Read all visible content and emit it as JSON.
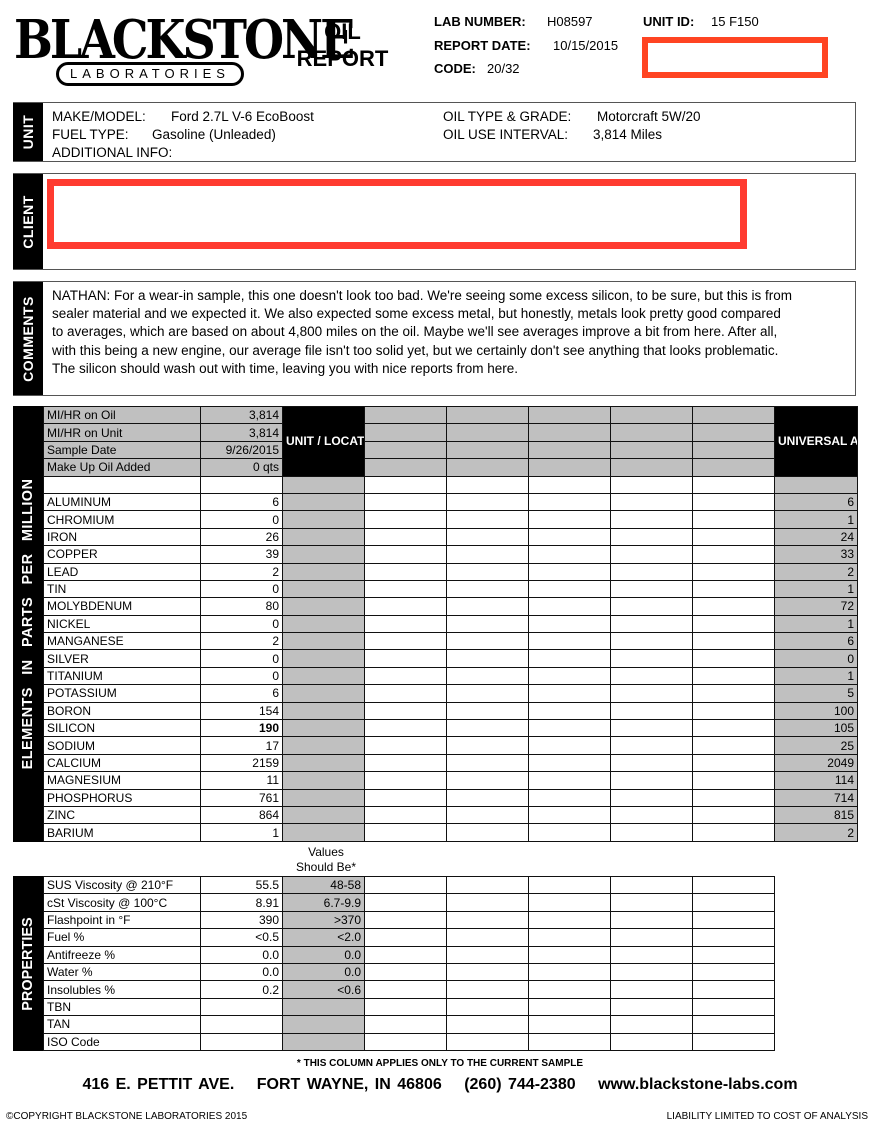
{
  "header": {
    "logo_main": "BLACKSTONE",
    "logo_sub": "LABORATORIES",
    "report_title_line1": "OIL",
    "report_title_line2": "REPORT",
    "lab_number_label": "LAB NUMBER:",
    "lab_number": "H08597",
    "report_date_label": "REPORT DATE:",
    "report_date": "10/15/2015",
    "code_label": "CODE:",
    "code": "20/32",
    "unit_id_label": "UNIT ID:",
    "unit_id": "15 F150",
    "redaction_color": "#ff4422"
  },
  "unit": {
    "section_label": "UNIT",
    "make_model_label": "MAKE/MODEL:",
    "make_model": "Ford 2.7L V-6 EcoBoost",
    "fuel_type_label": "FUEL TYPE:",
    "fuel_type": "Gasoline (Unleaded)",
    "additional_info_label": "ADDITIONAL INFO:",
    "additional_info": "",
    "oil_type_label": "OIL TYPE & GRADE:",
    "oil_type": "Motorcraft 5W/20",
    "oil_interval_label": "OIL USE INTERVAL:",
    "oil_interval": "3,814 Miles"
  },
  "client": {
    "section_label": "CLIENT",
    "redaction_color": "#ff3b30"
  },
  "comments": {
    "section_label": "COMMENTS",
    "text": "NATHAN:  For a wear-in sample, this one doesn't look too bad. We're seeing some excess silicon, to be sure, but this is from sealer material and we expected it. We also expected some excess metal, but honestly, metals look pretty good compared to averages, which are based on about 4,800 miles on the oil. Maybe we'll see averages improve a bit from here. After all, with this being a new engine, our average file isn't too solid yet, but we certainly don't see anything that looks problematic. The silicon should wash out with time, leaving you with nice reports from here."
  },
  "sample_info": [
    {
      "label": "MI/HR on Oil",
      "value": "3,814"
    },
    {
      "label": "MI/HR on Unit",
      "value": "3,814"
    },
    {
      "label": "Sample Date",
      "value": "9/26/2015"
    },
    {
      "label": "Make Up Oil Added",
      "value": "0 qts"
    }
  ],
  "unit_location_averages_header": "UNIT / LOCATION AVERAGES",
  "universal_averages_header": "UNIVERSAL AVERAGES",
  "elements_side_label": "ELEMENTS IN PARTS PER MILLION",
  "elements": [
    {
      "name": "ALUMINUM",
      "value": "6",
      "universal": "6"
    },
    {
      "name": "CHROMIUM",
      "value": "0",
      "universal": "1"
    },
    {
      "name": "IRON",
      "value": "26",
      "universal": "24"
    },
    {
      "name": "COPPER",
      "value": "39",
      "universal": "33"
    },
    {
      "name": "LEAD",
      "value": "2",
      "universal": "2"
    },
    {
      "name": "TIN",
      "value": "0",
      "universal": "1"
    },
    {
      "name": "MOLYBDENUM",
      "value": "80",
      "universal": "72"
    },
    {
      "name": "NICKEL",
      "value": "0",
      "universal": "1"
    },
    {
      "name": "MANGANESE",
      "value": "2",
      "universal": "6"
    },
    {
      "name": "SILVER",
      "value": "0",
      "universal": "0"
    },
    {
      "name": "TITANIUM",
      "value": "0",
      "universal": "1"
    },
    {
      "name": "POTASSIUM",
      "value": "6",
      "universal": "5"
    },
    {
      "name": "BORON",
      "value": "154",
      "universal": "100"
    },
    {
      "name": "SILICON",
      "value": "190",
      "universal": "105",
      "flagged": true
    },
    {
      "name": "SODIUM",
      "value": "17",
      "universal": "25"
    },
    {
      "name": "CALCIUM",
      "value": "2159",
      "universal": "2049"
    },
    {
      "name": "MAGNESIUM",
      "value": "11",
      "universal": "114"
    },
    {
      "name": "PHOSPHORUS",
      "value": "761",
      "universal": "714"
    },
    {
      "name": "ZINC",
      "value": "864",
      "universal": "815"
    },
    {
      "name": "BARIUM",
      "value": "1",
      "universal": "2"
    }
  ],
  "properties_side_label": "PROPERTIES",
  "should_be_header_line1": "Values",
  "should_be_header_line2": "Should Be*",
  "properties": [
    {
      "name": "SUS Viscosity @ 210°F",
      "value": "55.5",
      "should_be": "48-58"
    },
    {
      "name": "cSt Viscosity @ 100°C",
      "value": "8.91",
      "should_be": "6.7-9.9"
    },
    {
      "name": "Flashpoint in °F",
      "value": "390",
      "should_be": ">370"
    },
    {
      "name": "Fuel %",
      "value": "<0.5",
      "should_be": "<2.0"
    },
    {
      "name": "Antifreeze %",
      "value": "0.0",
      "should_be": "0.0"
    },
    {
      "name": "Water %",
      "value": "0.0",
      "should_be": "0.0"
    },
    {
      "name": "Insolubles %",
      "value": "0.2",
      "should_be": "<0.6"
    },
    {
      "name": "TBN",
      "value": "",
      "should_be": ""
    },
    {
      "name": "TAN",
      "value": "",
      "should_be": ""
    },
    {
      "name": "ISO Code",
      "value": "",
      "should_be": ""
    }
  ],
  "footer": {
    "footnote": "* THIS COLUMN APPLIES ONLY TO THE CURRENT SAMPLE",
    "street": "416 E. PETTIT AVE.",
    "city": "FORT WAYNE, IN  46806",
    "phone": "(260) 744-2380",
    "website": "www.blackstone-labs.com",
    "copyright": "©COPYRIGHT BLACKSTONE LABORATORIES  2015",
    "liability": "LIABILITY LIMITED TO COST OF ANALYSIS"
  }
}
